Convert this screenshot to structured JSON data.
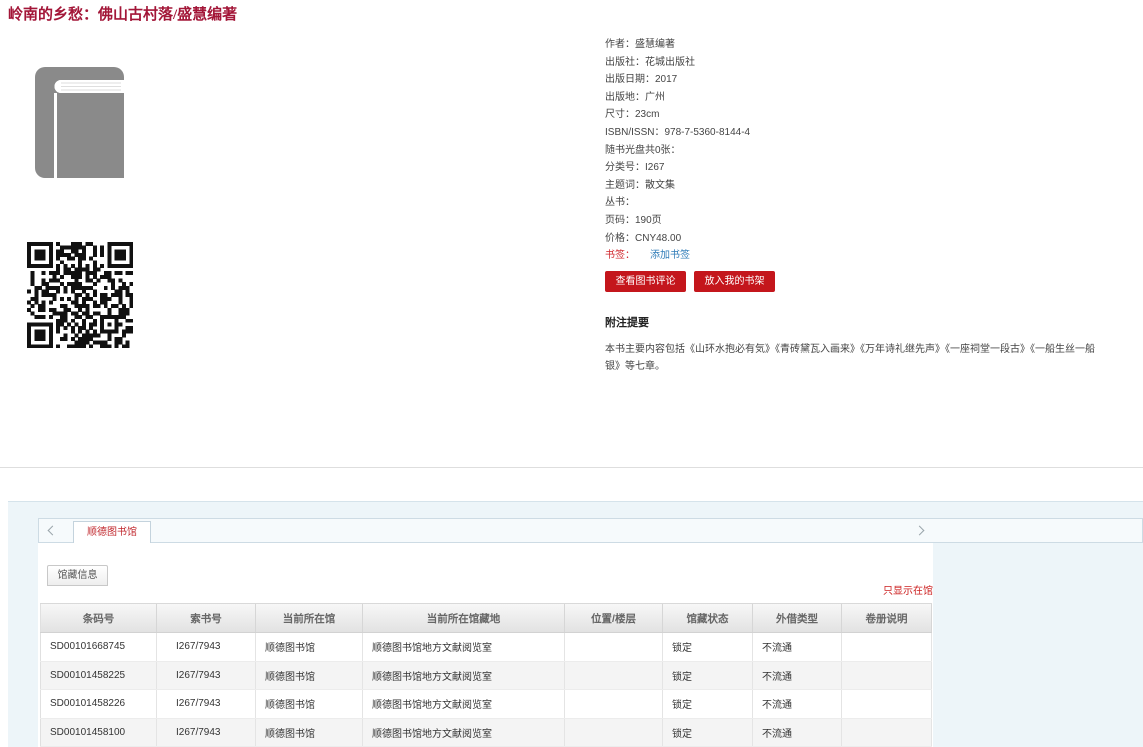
{
  "colors": {
    "title": "#a31638",
    "button": "#c4161c",
    "link": "#2f7cb8",
    "alert": "#d0272d",
    "holdings_background": "#edf5f9"
  },
  "icons": {
    "cover": "book-icon",
    "qr": "qr-code",
    "prev": "chevron-left-icon",
    "next": "chevron-right-icon"
  },
  "header": {
    "title": "岭南的乡愁：佛山古村落/盛慧编著"
  },
  "details": {
    "fields": [
      {
        "label": "作者：",
        "value": "盛慧编著"
      },
      {
        "label": "出版社：",
        "value": "花城出版社"
      },
      {
        "label": "出版日期：",
        "value": "2017"
      },
      {
        "label": "出版地：",
        "value": "广州"
      },
      {
        "label": "尺寸：",
        "value": "23cm"
      },
      {
        "label": "ISBN/ISSN：",
        "value": "978-7-5360-8144-4"
      },
      {
        "label": "随书光盘共0张：",
        "value": ""
      },
      {
        "label": "分类号：",
        "value": "I267"
      },
      {
        "label": "主题词：",
        "value": "散文集"
      },
      {
        "label": "丛书：",
        "value": ""
      },
      {
        "label": "页码：",
        "value": "190页"
      },
      {
        "label": "价格：",
        "value": "CNY48.00"
      }
    ],
    "bookmark": {
      "label": "书签：",
      "link": "添加书签"
    },
    "buttons": {
      "reviews": "查看图书评论",
      "shelf": "放入我的书架"
    },
    "notes": {
      "heading": "附注提要",
      "text": "本书主要内容包括《山环水抱必有気》《青砖黛瓦入画来》《万年诗礼继先声》《一座祠堂一段古》《一船生丝一船银》等七章。"
    }
  },
  "holdings": {
    "library_tabs": [
      {
        "label": "顺德图书馆",
        "active": true
      }
    ],
    "sub_tabs": [
      {
        "label": "馆藏信息",
        "active": true
      }
    ],
    "filter_link": "只显示在馆",
    "columns": [
      "条码号",
      "索书号",
      "当前所在馆",
      "当前所在馆藏地",
      "位置/楼层",
      "馆藏状态",
      "外借类型",
      "卷册说明"
    ],
    "rows": [
      {
        "barcode": "SD00101668745",
        "call_no": "I267/7943",
        "library": "顺德图书馆",
        "location": "顺德图书馆地方文献阅览室",
        "shelf": "",
        "status": "锁定",
        "loan_type": "不流通",
        "volume": ""
      },
      {
        "barcode": "SD00101458225",
        "call_no": "I267/7943",
        "library": "顺德图书馆",
        "location": "顺德图书馆地方文献阅览室",
        "shelf": "",
        "status": "锁定",
        "loan_type": "不流通",
        "volume": ""
      },
      {
        "barcode": "SD00101458226",
        "call_no": "I267/7943",
        "library": "顺德图书馆",
        "location": "顺德图书馆地方文献阅览室",
        "shelf": "",
        "status": "锁定",
        "loan_type": "不流通",
        "volume": ""
      },
      {
        "barcode": "SD00101458100",
        "call_no": "I267/7943",
        "library": "顺德图书馆",
        "location": "顺德图书馆地方文献阅览室",
        "shelf": "",
        "status": "锁定",
        "loan_type": "不流通",
        "volume": ""
      }
    ]
  }
}
